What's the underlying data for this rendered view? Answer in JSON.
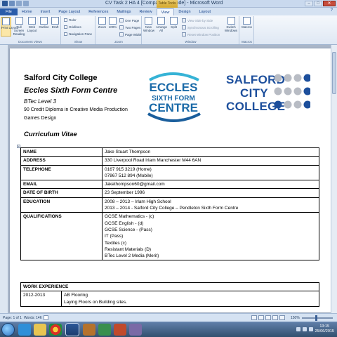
{
  "window": {
    "title": "CV Task 2 HA 4 [Compatibility Mode] - Microsoft Word",
    "context_tab": "Table Tools"
  },
  "tabs": [
    "File",
    "Home",
    "Insert",
    "Page Layout",
    "References",
    "Mailings",
    "Review",
    "View",
    "Design",
    "Layout"
  ],
  "active_tab": "View",
  "ribbon": {
    "document_views": {
      "label": "Document Views",
      "buttons": [
        "Print Layout",
        "Full Screen Reading",
        "Web Layout",
        "Outline",
        "Draft"
      ]
    },
    "show": {
      "label": "Show",
      "items": [
        "Ruler",
        "Gridlines",
        "Navigation Pane"
      ]
    },
    "zoom": {
      "label": "Zoom",
      "buttons": [
        "Zoom",
        "100%"
      ],
      "small": [
        "One Page",
        "Two Pages",
        "Page Width"
      ]
    },
    "window": {
      "label": "Window",
      "buttons": [
        "New Window",
        "Arrange All",
        "Split"
      ],
      "small": [
        "View Side by Side",
        "Synchronous Scrolling",
        "Reset Window Position"
      ],
      "switch": "Switch Windows"
    },
    "macros": {
      "label": "Macros",
      "button": "Macros"
    }
  },
  "document": {
    "college": "Salford City College",
    "centre": "Eccles Sixth Form Centre",
    "level": "BTec Level 3",
    "diploma": "90 Credit Diploma in Creative Media Production",
    "subject": "Games Design",
    "heading": "Curriculum Vitae",
    "logos": {
      "eccles": [
        "ECCLES",
        "SIXTH FORM",
        "CENTRE"
      ],
      "salford": [
        "SALFORD",
        "CITY",
        "COLLEGE"
      ]
    },
    "rows": [
      {
        "key": "NAME",
        "lines": [
          "Jake Stuart Thompson"
        ]
      },
      {
        "key": "ADDRESS",
        "lines": [
          "330 Liverpool Road Irlam Manchester M44 6AN"
        ]
      },
      {
        "key": "TELEPHONE",
        "lines": [
          "0167 915 3219 (Home)",
          "07867 512 894 (Mobile)"
        ]
      },
      {
        "key": "EMAIL",
        "lines": [
          "Jakethompson60@gmail.com"
        ]
      },
      {
        "key": "DATE OF BIRTH",
        "lines": [
          "23 September 1996"
        ]
      },
      {
        "key": "EDUCATION",
        "lines": [
          "2008 – 2013 – Irlam High School",
          "2013 – 2014 - Salford City College – Pendleton Sixth Form Centre"
        ]
      },
      {
        "key": "QUALIFICATIONS",
        "lines": [
          "GCSE Mathematics - (c)",
          "GCSE English - (d)",
          "GCSE Science - (Pass)",
          "IT (Pass)",
          "Textiles (c)",
          "Resistant Materials (D)",
          "BTec Level 2 Media (Merit)"
        ]
      }
    ],
    "work": {
      "header": "WORK EXPERIENCE",
      "period": "2012-2013",
      "lines": [
        "AB Flooring",
        "Laying Floors on Building sites."
      ]
    }
  },
  "status_bar": {
    "page": "Page: 1 of 1",
    "words": "Words: 146",
    "zoom": "150%"
  },
  "taskbar": {
    "time": "13:15",
    "date": "25/06/2015"
  }
}
